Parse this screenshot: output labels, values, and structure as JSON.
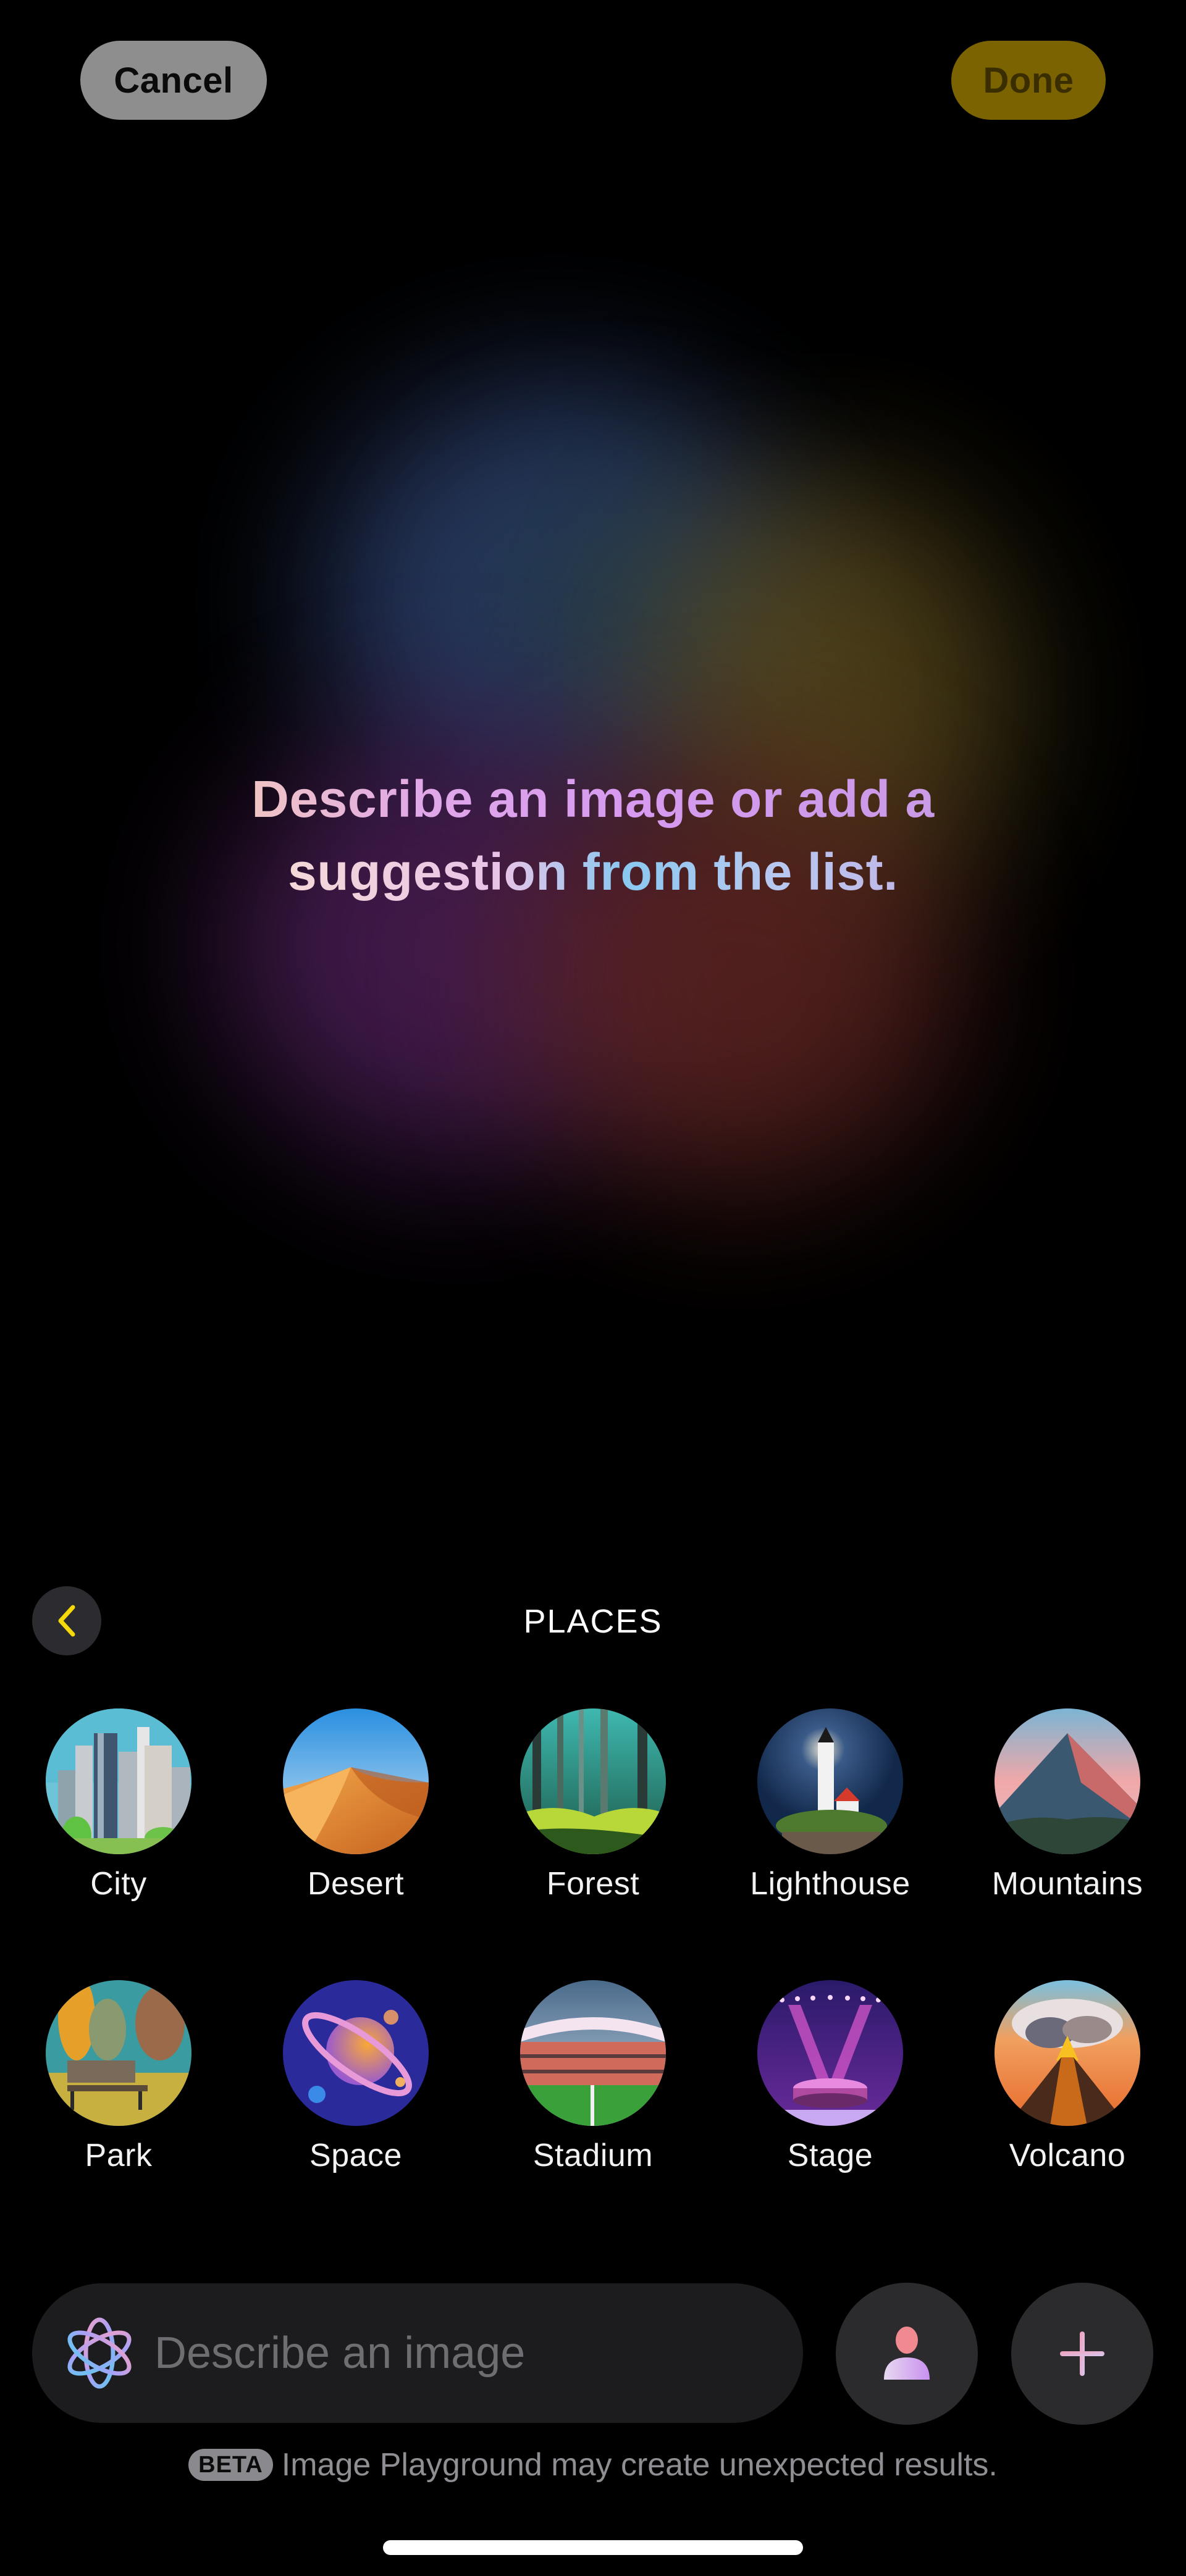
{
  "header": {
    "cancel_label": "Cancel",
    "done_label": "Done"
  },
  "canvas": {
    "prompt_line1": "Describe an image or add a",
    "prompt_line2": "suggestion from the list."
  },
  "suggestions": {
    "back_icon": "chevron-left-icon",
    "category": "PLACES",
    "items": [
      {
        "label": "City",
        "theme": "city"
      },
      {
        "label": "Desert",
        "theme": "desert"
      },
      {
        "label": "Forest",
        "theme": "forest"
      },
      {
        "label": "Lighthouse",
        "theme": "lighthouse"
      },
      {
        "label": "Mountains",
        "theme": "mountains"
      },
      {
        "label": "Park",
        "theme": "park"
      },
      {
        "label": "Space",
        "theme": "space"
      },
      {
        "label": "Stadium",
        "theme": "stadium"
      },
      {
        "label": "Stage",
        "theme": "stage"
      },
      {
        "label": "Volcano",
        "theme": "volcano"
      }
    ]
  },
  "composer": {
    "input_value": "",
    "input_placeholder": "Describe an image",
    "leading_icon": "image-playground-icon",
    "person_button_icon": "person-icon",
    "add_button_icon": "plus-icon"
  },
  "footer": {
    "badge": "BETA",
    "disclaimer": "Image Playground may create unexpected results."
  },
  "colors": {
    "accent_yellow": "#f5d90a",
    "done_bg": "#7a6300",
    "cancel_bg": "#8e8e8e"
  }
}
